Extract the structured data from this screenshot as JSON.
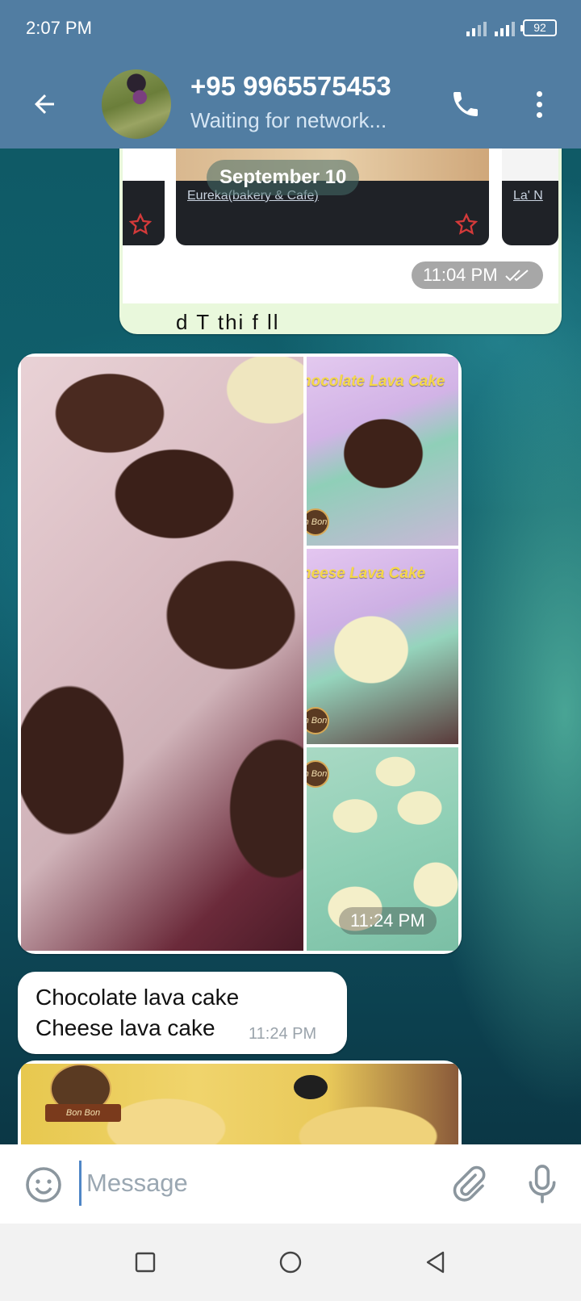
{
  "status_bar": {
    "time": "2:07 PM",
    "battery": "92"
  },
  "header": {
    "contact_name": "+95 9965575453",
    "contact_status": "Waiting for network..."
  },
  "chat": {
    "date_separator": "September 10",
    "forwarded_card": {
      "link_left": "Eureka(bakery & Cafe)",
      "link_right": "La' N",
      "truncated_text": "d T   thi  f   ll  ",
      "time": "11:04 PM"
    },
    "album": {
      "caption_1": "hocolate Lava Cake",
      "caption_2": "heese Lava Cake",
      "badge_text": "n Bon",
      "time": "11:24 PM"
    },
    "text_message": {
      "line1": "Chocolate lava cake",
      "line2": "Cheese lava cake",
      "time": "11:24 PM"
    },
    "last_image": {
      "ribbon_text": "Bon Bon"
    }
  },
  "input": {
    "placeholder": "Message"
  },
  "colors": {
    "header": "#517da2",
    "bubble_out": "#e9f8dc",
    "bubble_in": "#ffffff",
    "accent": "#4f86c6"
  },
  "icons": [
    "back-arrow-icon",
    "phone-icon",
    "more-vert-icon",
    "emoji-icon",
    "attach-icon",
    "mic-icon",
    "nav-square-icon",
    "nav-circle-icon",
    "nav-triangle-icon",
    "star-icon",
    "double-check-icon"
  ]
}
